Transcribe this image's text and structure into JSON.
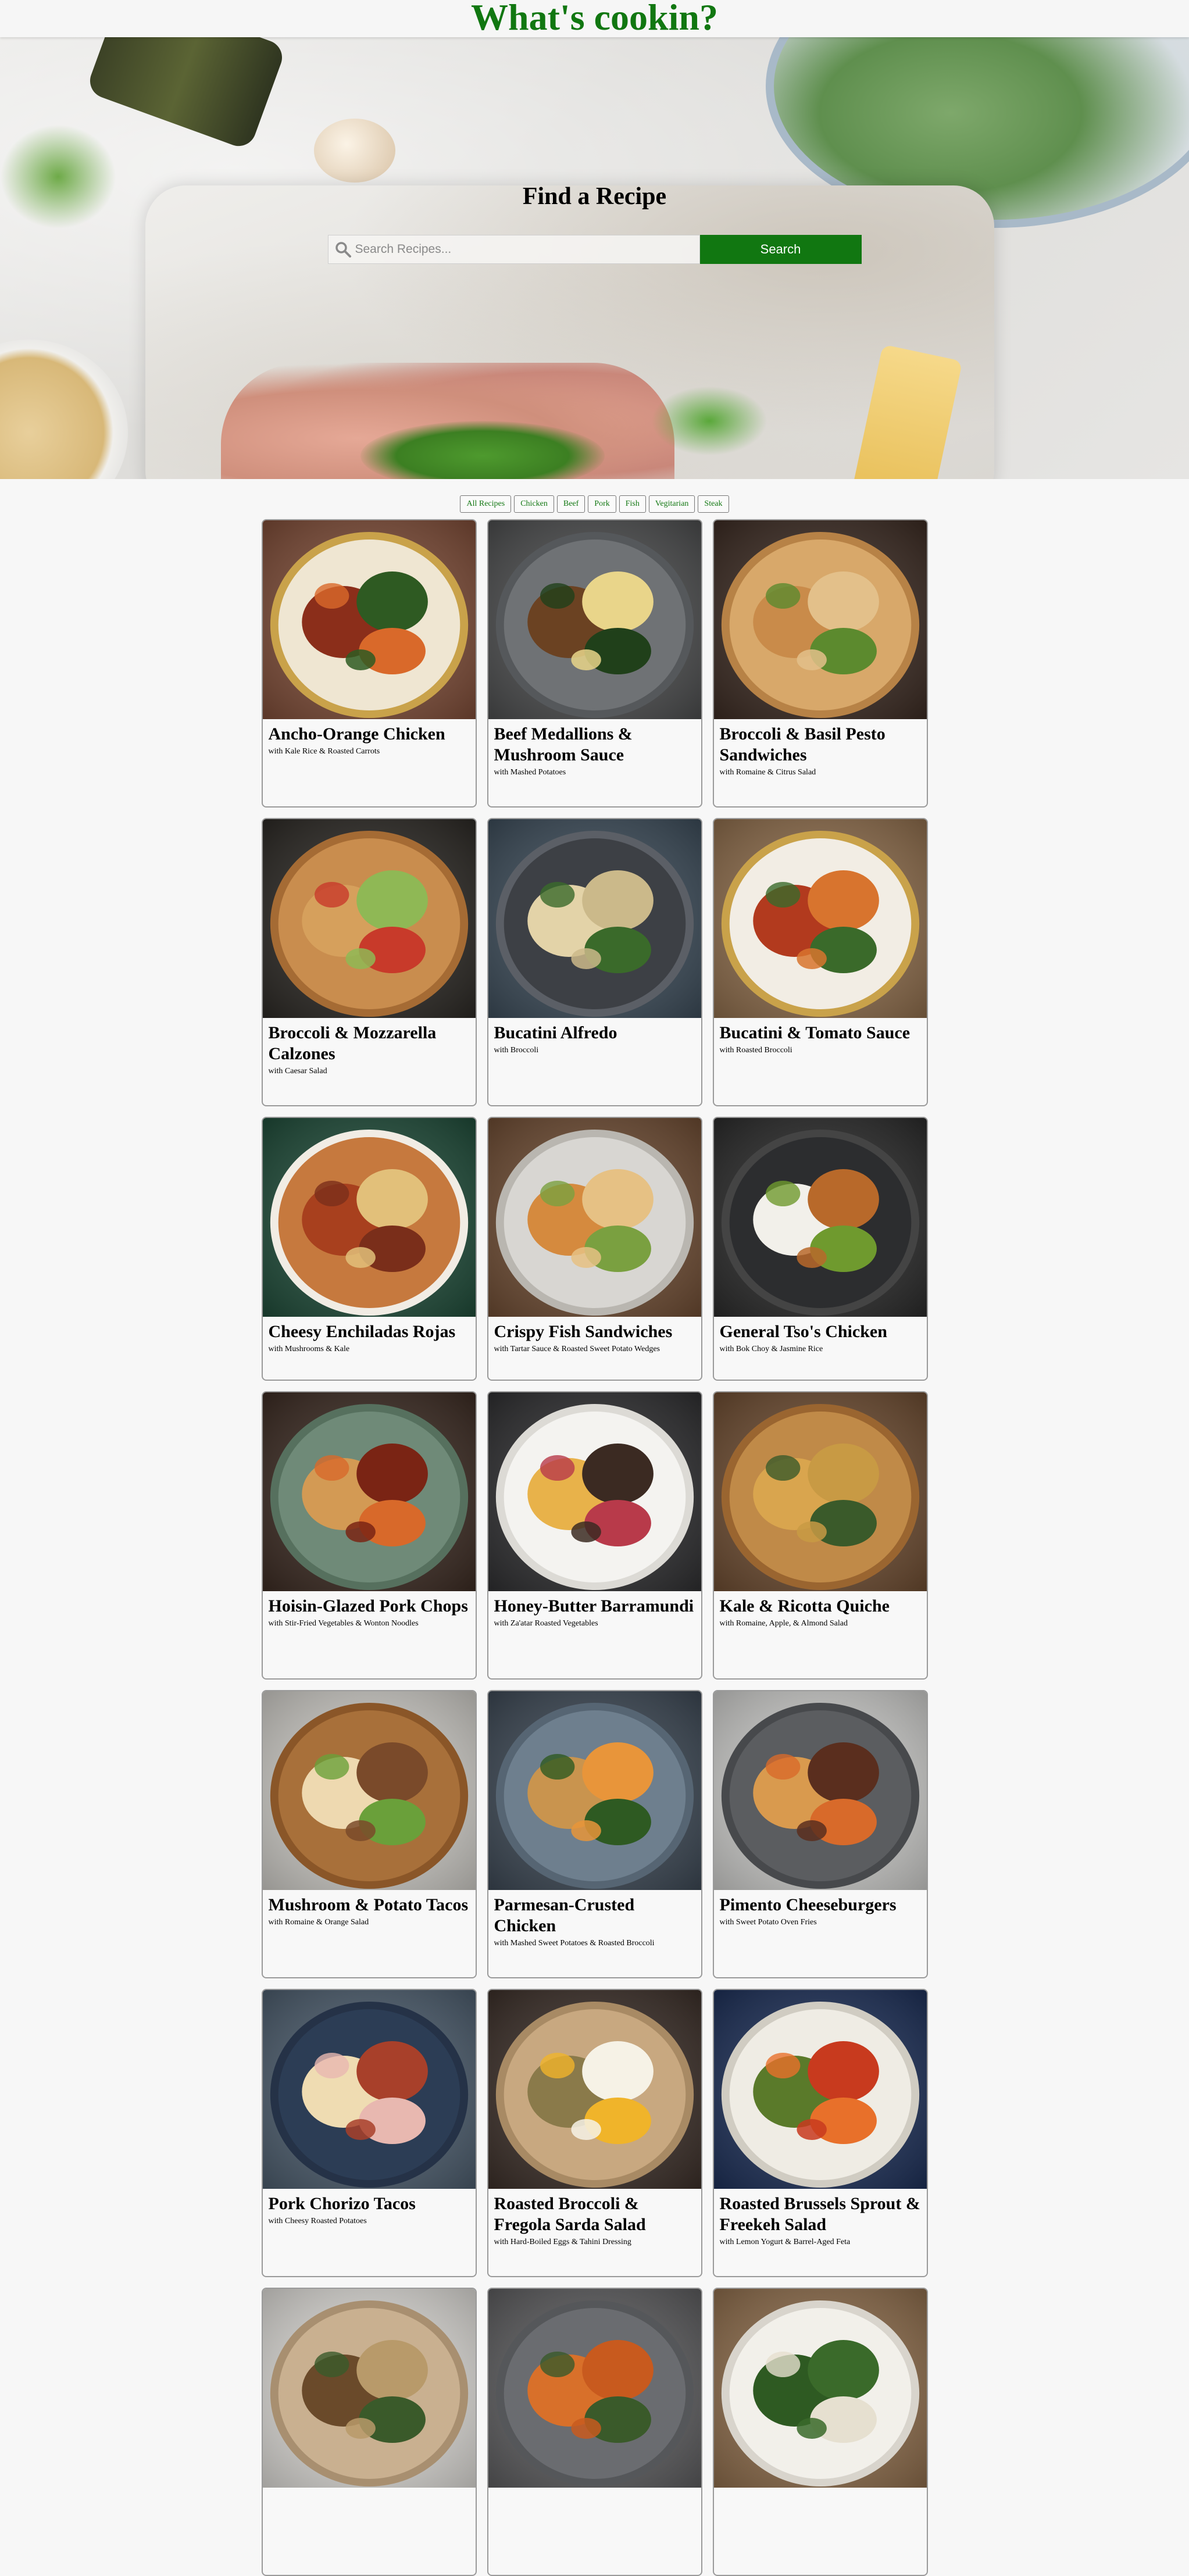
{
  "header": {
    "title": "What's cookin?"
  },
  "hero": {
    "heading": "Find a Recipe",
    "search_placeholder": "Search Recipes...",
    "search_button": "Search"
  },
  "filters": [
    "All Recipes",
    "Chicken",
    "Beef",
    "Pork",
    "Fish",
    "Vegitarian",
    "Steak"
  ],
  "recipes": [
    {
      "title": "Ancho-Orange Chicken",
      "subtitle": "with Kale Rice & Roasted Carrots",
      "plate": "#efe6d2",
      "rim": "#c9a24a",
      "bg": "#7a4a36",
      "food": [
        "#8b2e1a",
        "#2e5a22",
        "#d9692a"
      ]
    },
    {
      "title": "Beef Medallions & Mushroom Sauce",
      "subtitle": "with Mashed Potatoes",
      "plate": "#6f7275",
      "rim": "#55585b",
      "bg": "#4a4b4c",
      "food": [
        "#6b4222",
        "#e9d58a",
        "#20401a"
      ]
    },
    {
      "title": "Broccoli & Basil Pesto Sandwiches",
      "subtitle": "with Romaine & Citrus Salad",
      "plate": "#d8a86a",
      "rim": "#b78246",
      "bg": "#3a2a22",
      "food": [
        "#c98b4a",
        "#e3c08a",
        "#5c8a2e"
      ]
    },
    {
      "title": "Broccoli & Mozzarella Calzones",
      "subtitle": "with Caesar Salad",
      "plate": "#c98d4e",
      "rim": "#a56b34",
      "bg": "#2b2824",
      "food": [
        "#d6a05c",
        "#8fb855",
        "#c83a2a"
      ]
    },
    {
      "title": "Bucatini Alfredo",
      "subtitle": "with Broccoli",
      "plate": "#3d4045",
      "rim": "#5b5f66",
      "bg": "#3b4a57",
      "food": [
        "#e3d3a8",
        "#cbb98a",
        "#3a6a2a"
      ]
    },
    {
      "title": "Bucatini & Tomato Sauce",
      "subtitle": "with Roasted Broccoli",
      "plate": "#f2ede4",
      "rim": "#c9a24a",
      "bg": "#8a6a4a",
      "food": [
        "#b23a1e",
        "#d8742e",
        "#3a6a2a"
      ]
    },
    {
      "title": "Cheesy Enchiladas Rojas",
      "subtitle": "with Mushrooms & Kale",
      "plate": "#c6793e",
      "rim": "#f1ece4",
      "bg": "#1f4a38",
      "food": [
        "#a8401e",
        "#e2c07a",
        "#7a2e1a"
      ]
    },
    {
      "title": "Crispy Fish Sandwiches",
      "subtitle": "with Tartar Sauce & Roasted Sweet Potato Wedges",
      "plate": "#d8d6d2",
      "rim": "#b9b6b0",
      "bg": "#6b4a32",
      "food": [
        "#d58a3e",
        "#e6c184",
        "#7aa040"
      ]
    },
    {
      "title": "General Tso's Chicken",
      "subtitle": "with Bok Choy & Jasmine Rice",
      "plate": "#2c2d2f",
      "rim": "#444",
      "bg": "#2a2a2a",
      "food": [
        "#f2f0ea",
        "#b8692a",
        "#6f9a2e"
      ]
    },
    {
      "title": "Hoisin-Glazed Pork Chops",
      "subtitle": "with Stir-Fried Vegetables & Wonton Noodles",
      "plate": "#6f8a78",
      "rim": "#56705e",
      "bg": "#3a2a22",
      "food": [
        "#d39a54",
        "#7a2414",
        "#d8692a"
      ]
    },
    {
      "title": "Honey-Butter Barramundi",
      "subtitle": "with Za'atar Roasted Vegetables",
      "plate": "#f4f3f0",
      "rim": "#dcdad5",
      "bg": "#2e2e30",
      "food": [
        "#e8b24a",
        "#3b2a22",
        "#b83a4a"
      ]
    },
    {
      "title": "Kale & Ricotta Quiche",
      "subtitle": "with Romaine, Apple, & Almond Salad",
      "plate": "#c08a48",
      "rim": "#9a6530",
      "bg": "#6a4a30",
      "food": [
        "#d9a54e",
        "#c89a44",
        "#3a5a2a"
      ]
    },
    {
      "title": "Mushroom & Potato Tacos",
      "subtitle": "with Romaine & Orange Salad",
      "plate": "#a8703a",
      "rim": "#8a5628",
      "bg": "#c9c7c2",
      "food": [
        "#eed9b0",
        "#7a4a2a",
        "#6aa03a"
      ]
    },
    {
      "title": "Parmesan-Crusted Chicken",
      "subtitle": "with Mashed Sweet Potatoes & Roasted Broccoli",
      "plate": "#6e7f8e",
      "rim": "#566573",
      "bg": "#3b4652",
      "food": [
        "#c9944e",
        "#e8953a",
        "#2e5a22"
      ]
    },
    {
      "title": "Pimento Cheeseburgers",
      "subtitle": "with Sweet Potato Oven Fries",
      "plate": "#5b5d60",
      "rim": "#47494c",
      "bg": "#c8c8c6",
      "food": [
        "#d99a4e",
        "#5a2e1e",
        "#d86a2a"
      ]
    },
    {
      "title": "Pork Chorizo Tacos",
      "subtitle": "with Cheesy Roasted Potatoes",
      "plate": "#2c3d55",
      "rim": "#253247",
      "bg": "#4a5a6a",
      "food": [
        "#efdcb2",
        "#a8402a",
        "#e8b8b0"
      ]
    },
    {
      "title": "Roasted Broccoli & Fregola Sarda Salad",
      "subtitle": "with Hard-Boiled Eggs & Tahini Dressing",
      "plate": "#c8a880",
      "rim": "#a88a64",
      "bg": "#3a2e28",
      "food": [
        "#8a7a4a",
        "#f6f2e6",
        "#f0b42a"
      ]
    },
    {
      "title": "Roasted Brussels Sprout & Freekeh Salad",
      "subtitle": "with Lemon Yogurt & Barrel-Aged Feta",
      "plate": "#efece4",
      "rim": "#d0ccc2",
      "bg": "#1d2f56",
      "food": [
        "#5a7a2a",
        "#c83a1e",
        "#e8702a"
      ]
    },
    {
      "title": "",
      "subtitle": "",
      "plate": "#c9b090",
      "rim": "#a88f70",
      "bg": "#d8d6d2",
      "food": [
        "#6a4a2a",
        "#b89a6a",
        "#3a5a2a"
      ]
    },
    {
      "title": "",
      "subtitle": "",
      "plate": "#6a6c70",
      "rim": "#55575a",
      "bg": "#5a5a5c",
      "food": [
        "#d8702a",
        "#c85a1e",
        "#3a5a2a"
      ]
    },
    {
      "title": "",
      "subtitle": "",
      "plate": "#f2f0ea",
      "rim": "#d8d4cc",
      "bg": "#8a6a4a",
      "food": [
        "#2e5a22",
        "#3a6a2a",
        "#e6e0d0"
      ]
    }
  ]
}
